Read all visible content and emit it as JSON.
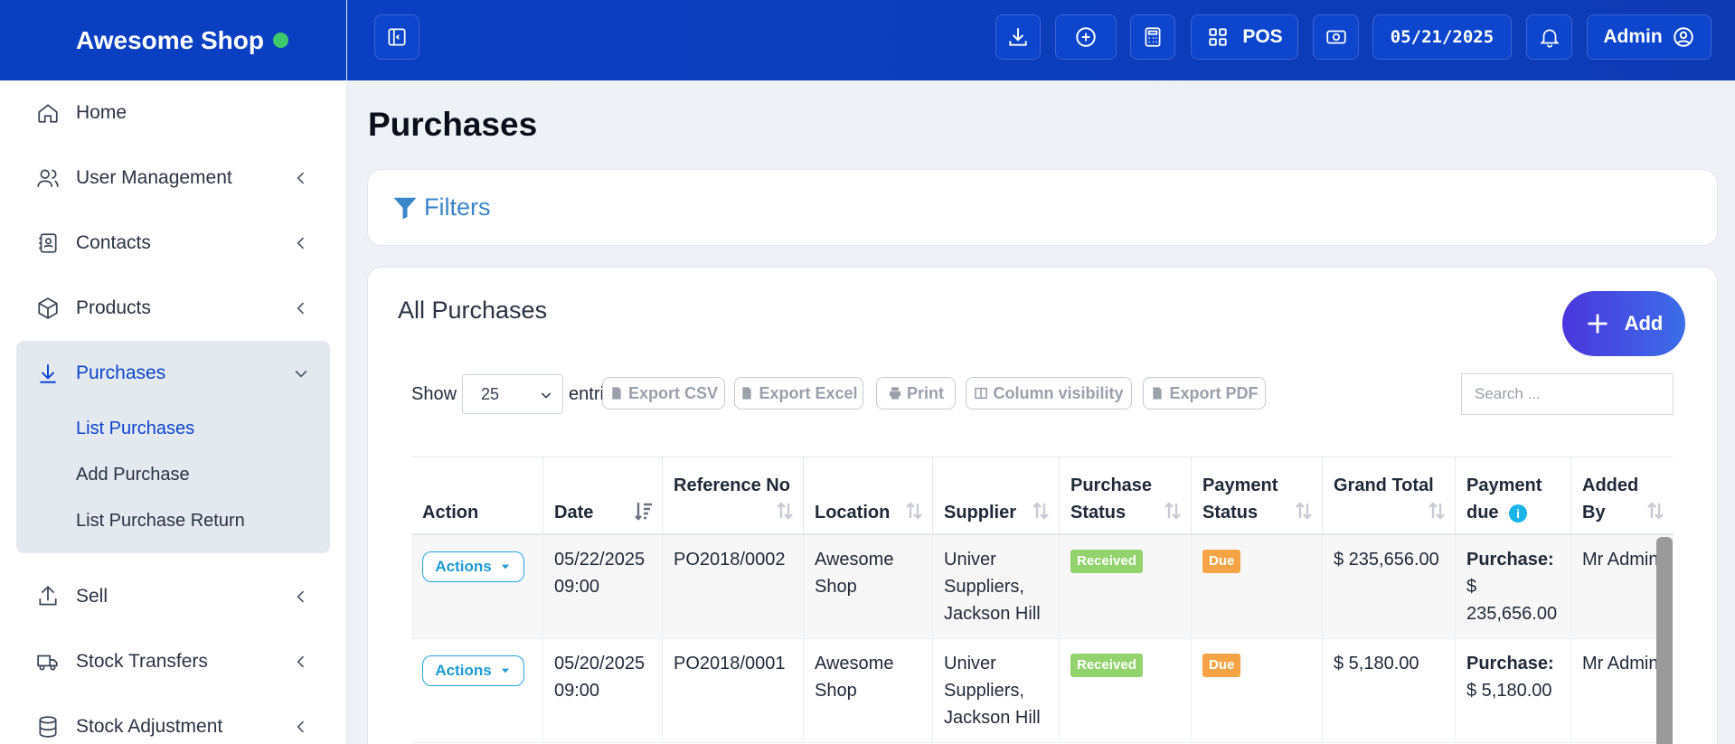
{
  "brand": {
    "name": "Awesome Shop",
    "status_color": "#3ec96a"
  },
  "sidebar": {
    "items": [
      {
        "label": "Home",
        "icon": "home-icon"
      },
      {
        "label": "User Management",
        "icon": "users-icon"
      },
      {
        "label": "Contacts",
        "icon": "contacts-icon"
      },
      {
        "label": "Products",
        "icon": "box-icon"
      },
      {
        "label": "Purchases",
        "icon": "download-icon"
      },
      {
        "label": "Sell",
        "icon": "upload-icon"
      },
      {
        "label": "Stock Transfers",
        "icon": "truck-icon"
      },
      {
        "label": "Stock Adjustment",
        "icon": "database-icon"
      }
    ],
    "purchases_sub": [
      "List Purchases",
      "Add Purchase",
      "List Purchase Return"
    ]
  },
  "topbar": {
    "pos_label": "POS",
    "date": "05/21/2025",
    "user": "Admin"
  },
  "page": {
    "title": "Purchases",
    "filters_label": "Filters"
  },
  "card": {
    "title": "All Purchases",
    "add_label": "Add",
    "show_label": "Show",
    "entries_value": "25",
    "entries_label": "entries",
    "search_placeholder": "Search ...",
    "exports": [
      "Export CSV",
      "Export Excel",
      "Print",
      "Column visibility",
      "Export PDF"
    ]
  },
  "table": {
    "headers": [
      "Action",
      "Date",
      "Reference No",
      "Location",
      "Supplier",
      "Purchase Status",
      "Payment Status",
      "Grand Total",
      "Payment due",
      "Added By"
    ],
    "rows": [
      {
        "action": "Actions",
        "date": "05/22/2025 09:00",
        "ref": "PO2018/0002",
        "location": "Awesome Shop",
        "supplier": "Univer Suppliers, Jackson Hill",
        "purchase_status": "Received",
        "payment_status": "Due",
        "grand_total": "$ 235,656.00",
        "due_label": "Purchase:",
        "due_value": "$ 235,656.00",
        "added_by": "Mr Admin"
      },
      {
        "action": "Actions",
        "date": "05/20/2025 09:00",
        "ref": "PO2018/0001",
        "location": "Awesome Shop",
        "supplier": "Univer Suppliers, Jackson Hill",
        "purchase_status": "Received",
        "payment_status": "Due",
        "grand_total": "$ 5,180.00",
        "due_label": "Purchase:",
        "due_value": "$ 5,180.00",
        "added_by": "Mr Admin"
      }
    ]
  }
}
